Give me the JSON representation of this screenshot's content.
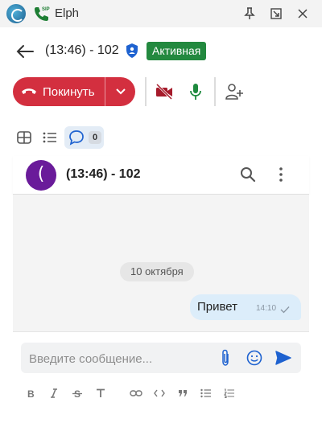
{
  "window": {
    "title": "Elph",
    "sip_badge": "SIP",
    "controls": [
      "pin-icon",
      "restore-icon",
      "close-icon"
    ]
  },
  "header": {
    "call_title": "(13:46) - 102",
    "status": "Активная",
    "status_color": "#23893f"
  },
  "controls": {
    "leave_label": "Покинуть",
    "leave_color": "#d32f3f",
    "icons": [
      "phone-hangup-icon",
      "chevron-down-icon",
      "video-off-icon",
      "microphone-icon",
      "add-user-icon"
    ]
  },
  "views": {
    "icons": [
      "grid-icon",
      "list-icon",
      "chat-icon"
    ],
    "chat_count": "0"
  },
  "chat": {
    "avatar_letter": "(",
    "avatar_color": "#6a1b9a",
    "name": "(13:46) - 102",
    "date_separator": "10 октября",
    "messages": [
      {
        "text": "Привет",
        "time": "14:10",
        "status": "sent"
      }
    ]
  },
  "composer": {
    "placeholder": "Введите сообщение...",
    "icons": [
      "attach-icon",
      "emoji-icon",
      "send-icon"
    ],
    "format_tools": [
      "bold-icon",
      "italic-icon",
      "strikethrough-icon",
      "text-icon",
      "link-icon",
      "code-icon",
      "quote-icon",
      "bullet-list-icon",
      "numbered-list-icon"
    ]
  }
}
